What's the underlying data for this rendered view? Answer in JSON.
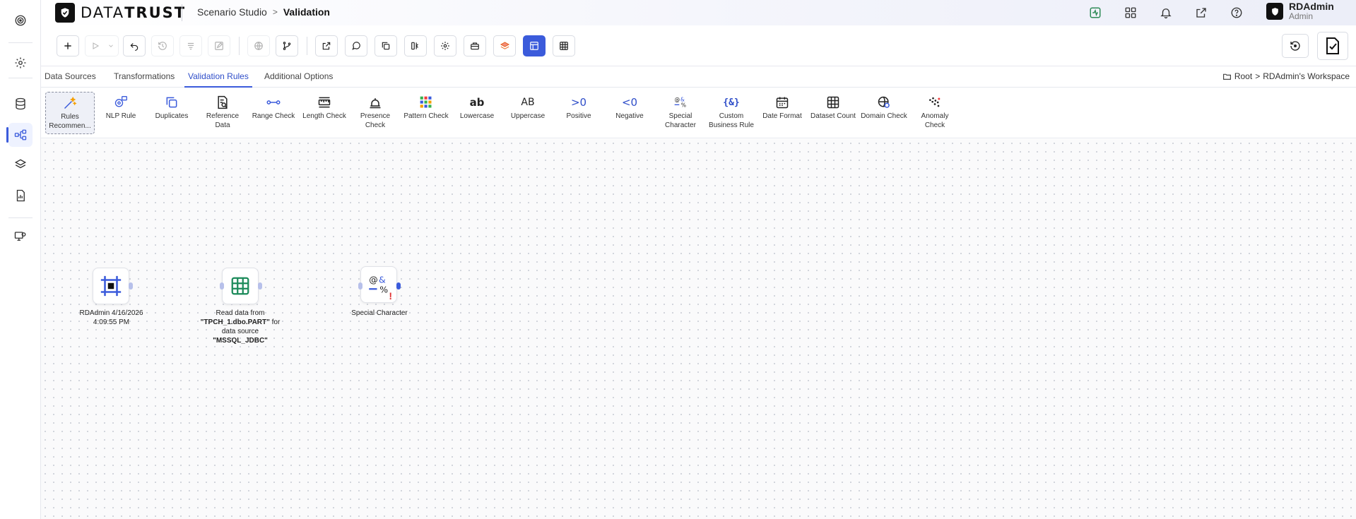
{
  "brand": {
    "name_light": "DATA",
    "name_bold": "TRUST"
  },
  "breadcrumb": {
    "studio": "Scenario Studio",
    "current": "Validation"
  },
  "user": {
    "name": "RDAdmin",
    "role": "Admin"
  },
  "tabs": [
    {
      "label": "Data Sources",
      "active": false
    },
    {
      "label": "Transformations",
      "active": false
    },
    {
      "label": "Validation Rules",
      "active": true
    },
    {
      "label": "Additional Options",
      "active": false
    }
  ],
  "workspace_path": {
    "root": "Root",
    "workspace": "RDAdmin's Workspace"
  },
  "palette": [
    {
      "label": "Rules Recommen...",
      "icon": "magic-wand-icon"
    },
    {
      "label": "NLP Rule",
      "icon": "nlp-icon"
    },
    {
      "label": "Duplicates",
      "icon": "duplicates-icon"
    },
    {
      "label": "Reference Data",
      "icon": "reference-data-icon"
    },
    {
      "label": "Range Check",
      "icon": "range-icon"
    },
    {
      "label": "Length Check",
      "icon": "ruler-icon"
    },
    {
      "label": "Presence Check",
      "icon": "bell-icon"
    },
    {
      "label": "Pattern Check",
      "icon": "pattern-icon"
    },
    {
      "label": "Lowercase",
      "glyph": "ab"
    },
    {
      "label": "Uppercase",
      "glyph": "AB"
    },
    {
      "label": "Positive",
      "glyph": ">0"
    },
    {
      "label": "Negative",
      "glyph": "<0"
    },
    {
      "label": "Special Character",
      "icon": "special-character-icon"
    },
    {
      "label": "Custom Business Rule",
      "glyph": "{&}"
    },
    {
      "label": "Date Format",
      "icon": "calendar-icon"
    },
    {
      "label": "Dataset Count",
      "icon": "grid-icon"
    },
    {
      "label": "Domain Check",
      "icon": "globe-icon"
    },
    {
      "label": "Anomaly Check",
      "icon": "anomaly-icon"
    }
  ],
  "nodes": {
    "scenario": {
      "label": "RDAdmin 4/16/2026 4:09:55 PM"
    },
    "read": {
      "prefix": "Read data from ",
      "table": "\"TPCH_1.dbo.PART\"",
      "middle": " for data source ",
      "source": "\"MSSQL_JDBC\""
    },
    "special": {
      "label": "Special Character",
      "warning": "!"
    }
  },
  "colors": {
    "accent": "#3b5bdb",
    "green": "#2e8b57",
    "warning": "#e03131"
  }
}
